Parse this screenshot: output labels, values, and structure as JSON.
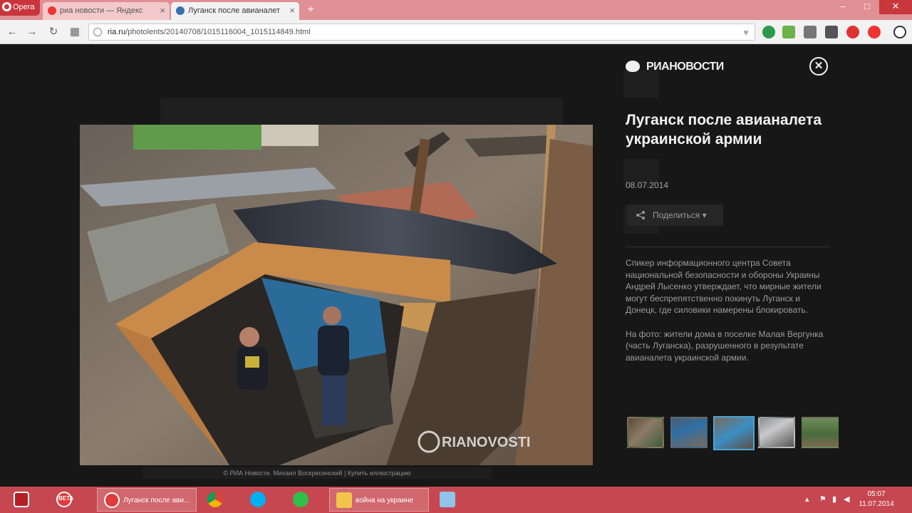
{
  "browser": {
    "menu_label": "Opera",
    "tabs": [
      {
        "title": "риа новости — Яндекс",
        "active": false
      },
      {
        "title": "Луганск после авианалет",
        "active": true
      }
    ],
    "new_tab": "+",
    "url_domain": "ria.ru",
    "url_path": "/photolents/20140708/1015116004_1015114849.html",
    "window_controls": [
      "–",
      "□",
      "✕"
    ]
  },
  "gallery": {
    "logo": "РИАНОВОСТИ",
    "close": "✕",
    "title": "Луганск после авианалета украинской армии",
    "date": "08.07.2014",
    "share_label": "Поделиться ▾",
    "description": [
      "Спикер информационного центра Совета национальной безопасности и обороны Украины Андрей Лысенко утверждает, что мирные жители могут беспрепятственно покинуть Луганск и Донецк, где силовики намерены блокировать.",
      "На фото: жители дома в поселке Малая Вергунка (часть Луганска), разрушенного в результате авианалета украинской армии."
    ],
    "photo_watermark": "RIANOVOSTI",
    "photo_caption": "© РИА Новости. Михаил Воскресенский | Купить иллюстрацию",
    "thumbnails": [
      {
        "name": "thumb-1",
        "selected": false
      },
      {
        "name": "thumb-2",
        "selected": false
      },
      {
        "name": "thumb-3",
        "selected": true
      },
      {
        "name": "thumb-4",
        "selected": false
      },
      {
        "name": "thumb-5",
        "selected": false
      }
    ],
    "accent_color": "#48a7d8"
  },
  "taskbar": {
    "items": [
      {
        "name": "power",
        "label": ""
      },
      {
        "name": "opera-beta",
        "label": "BETA"
      },
      {
        "name": "opera-window",
        "label": "Луганск после ави..."
      },
      {
        "name": "chrome",
        "label": ""
      },
      {
        "name": "skype",
        "label": ""
      },
      {
        "name": "mail-agent",
        "label": ""
      },
      {
        "name": "explorer-folder",
        "label": "война на украине"
      },
      {
        "name": "media",
        "label": ""
      }
    ],
    "time": "05:07",
    "date": "11.07.2014",
    "color": "#c6474f"
  }
}
